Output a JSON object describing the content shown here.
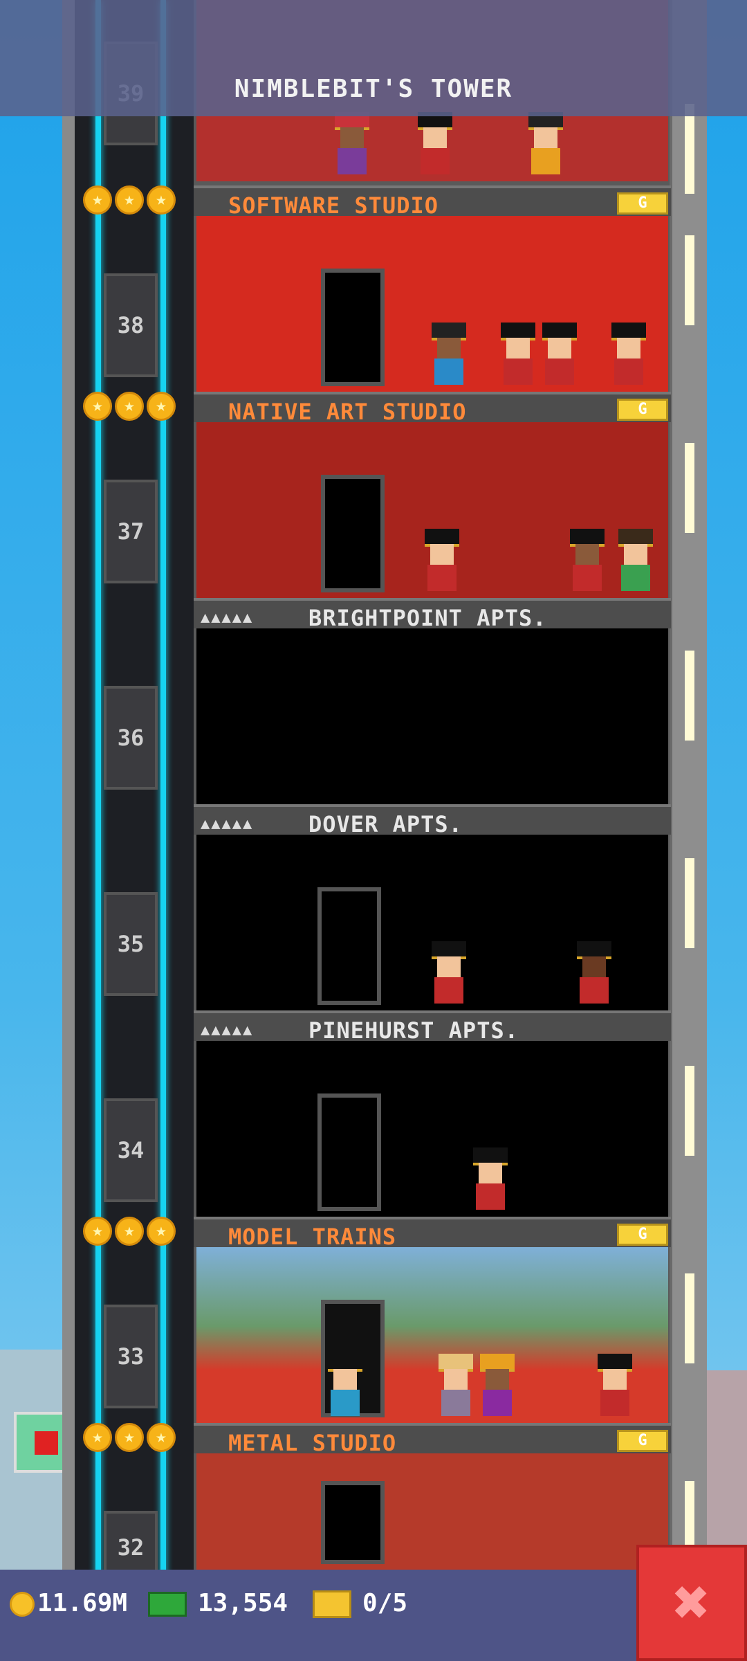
{
  "header": {
    "title": "NIMBLEBIT'S TOWER"
  },
  "floors": [
    {
      "number": "39",
      "name": "",
      "kind": "business",
      "color": "#b3302d"
    },
    {
      "number": "38",
      "name": "SOFTWARE STUDIO",
      "kind": "business",
      "color": "#d52a1f"
    },
    {
      "number": "37",
      "name": "NATIVE ART STUDIO",
      "kind": "business",
      "color": "#a7241d"
    },
    {
      "number": "36",
      "name": "BRIGHTPOINT APTS.",
      "kind": "apartment",
      "color": "#000000"
    },
    {
      "number": "35",
      "name": "DOVER APTS.",
      "kind": "apartment",
      "color": "#000000"
    },
    {
      "number": "34",
      "name": "PINEHURST APTS.",
      "kind": "apartment",
      "color": "#000000"
    },
    {
      "number": "33",
      "name": "MODEL TRAINS",
      "kind": "business",
      "color": "#4a7a8a"
    },
    {
      "number": "32",
      "name": "METAL STUDIO",
      "kind": "business",
      "color": "#b53a2a"
    }
  ],
  "business_tag": "G",
  "apartment_residents": "▲▲▲▲▲",
  "stars_glyph": "★",
  "status": {
    "coins": "11.69M",
    "bux": "13,554",
    "tickets": "0/5"
  },
  "icons": {
    "coins": "coin-icon",
    "bux": "bux-icon",
    "tickets": "ticket-icon",
    "close": "close-icon"
  },
  "close_glyph": "✖",
  "colors": {
    "rail": "#16d3f0",
    "close": "#e43838",
    "bar": "#4e5487",
    "biz_label": "#ff8a3a"
  }
}
